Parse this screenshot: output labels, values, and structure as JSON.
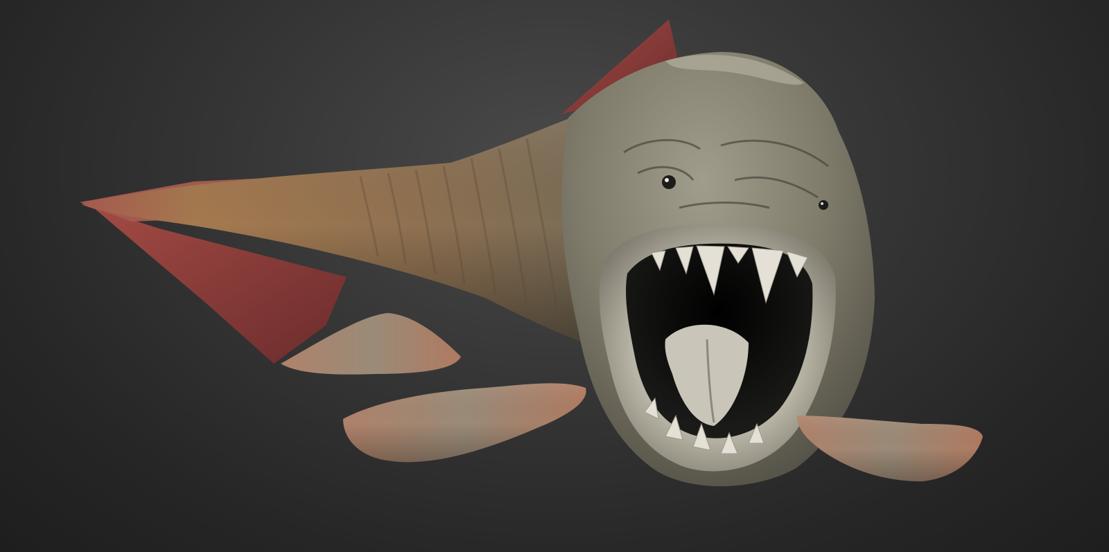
{
  "scene": {
    "subject_icon": "armored-fish-creature-icon",
    "colors": {
      "background_top": "#4a4a4a",
      "background_bottom": "#1e1e1e",
      "skin_head": "#8a8676",
      "skin_body": "#9a7a58",
      "fin_red": "#8e3f3e",
      "mouth_inner": "#0b0b0b",
      "tongue": "#c9c5b8",
      "teeth": "#e4e0d6"
    }
  }
}
